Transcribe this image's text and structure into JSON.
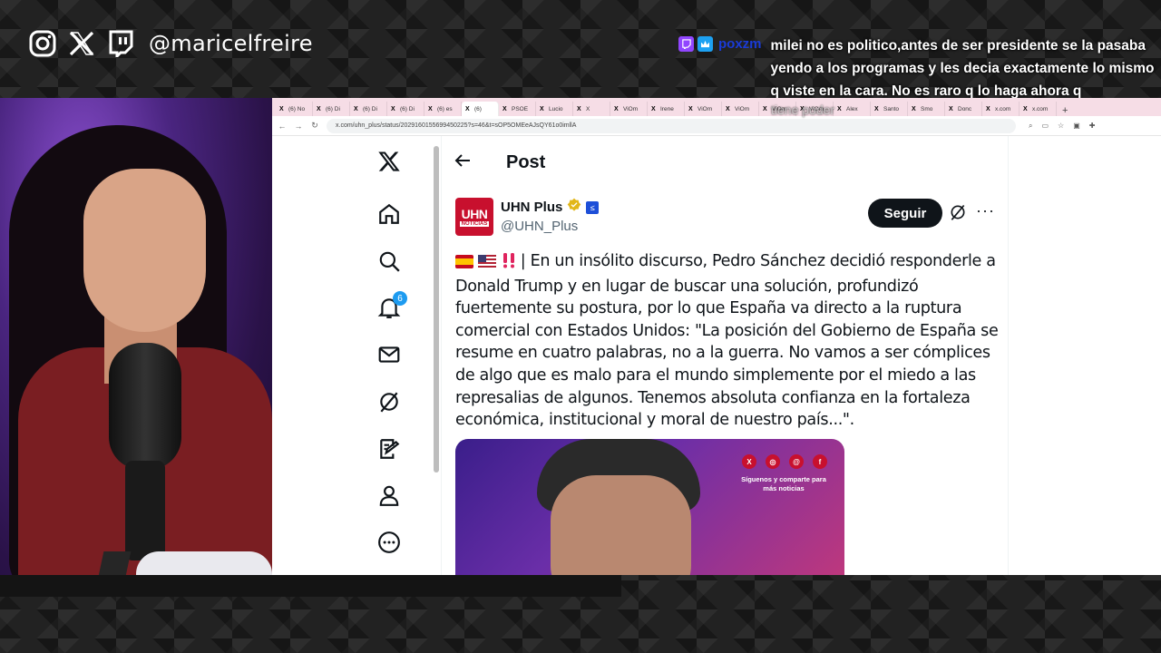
{
  "streamer": {
    "handle": "@maricelfreire",
    "social_icons": [
      "instagram-icon",
      "x-icon",
      "twitch-icon"
    ]
  },
  "chat": {
    "username": "poxzm",
    "message": "milei no es politico,antes de ser presidente se la pasaba yendo a los programas y les decia exactamente lo mismo q viste en la cara. No es raro q lo haga ahora q",
    "faded_text": "tiene poder",
    "badges": [
      "twitch-icon",
      "crown-badge-icon"
    ]
  },
  "browser": {
    "tabs": [
      {
        "label": "(6) No"
      },
      {
        "label": "(6) Di"
      },
      {
        "label": "(6) Di"
      },
      {
        "label": "(6) Di"
      },
      {
        "label": "(6) es"
      },
      {
        "label": "(6)"
      },
      {
        "label": "PSOE"
      },
      {
        "label": "Lucio"
      },
      {
        "label": "X"
      },
      {
        "label": "ViOm"
      },
      {
        "label": "Irene"
      },
      {
        "label": "ViOm"
      },
      {
        "label": "ViOm"
      },
      {
        "label": "ViOm"
      },
      {
        "label": "ViOm"
      },
      {
        "label": "Alex"
      },
      {
        "label": "Santo"
      },
      {
        "label": "Smo"
      },
      {
        "label": "Donc"
      },
      {
        "label": "x.com"
      },
      {
        "label": "x.com"
      }
    ],
    "url": "x.com/uhn_plus/status/2029160155699450225?s=46&t=sOP5OMEeAJsQY61o0imllA"
  },
  "x_app": {
    "nav": [
      {
        "name": "x-logo-icon"
      },
      {
        "name": "home-icon"
      },
      {
        "name": "search-icon"
      },
      {
        "name": "notifications-icon",
        "badge": "6"
      },
      {
        "name": "messages-icon"
      },
      {
        "name": "grok-icon"
      },
      {
        "name": "compose-icon"
      },
      {
        "name": "profile-icon"
      },
      {
        "name": "more-icon"
      }
    ],
    "post_header": "Post",
    "author": {
      "avatar_text": "UHN",
      "avatar_sub": "NOTICIAS",
      "name": "UHN Plus",
      "handle": "@UHN_Plus"
    },
    "follow_label": "Seguir",
    "more_label": "···",
    "post_body": " | En un insólito discurso, Pedro Sánchez decidió responderle a Donald Trump y en lugar de buscar una solución, profundizó fuertemente su postura, por lo que España va directo a la ruptura comercial con Estados Unidos: \"La posición del Gobierno de España se resume en cuatro palabras, no a la guerra. No vamos a ser cómplices de algo que es malo para el mundo simplemente por el miedo a las represalias de algunos. Tenemos absoluta confianza en la fortaleza económica, institucional y moral de nuestro país...\".",
    "post_emojis": [
      "spain-flag-icon",
      "us-flag-icon",
      "double-exclamation-icon"
    ],
    "image": {
      "caption": "Síguenos y comparte para más noticias",
      "social_icons": [
        "x-icon",
        "instagram-icon",
        "threads-icon",
        "facebook-icon"
      ]
    }
  },
  "colors": {
    "x_blue": "#1d9bf0",
    "uhn_red": "#c8102e",
    "chat_username": "#1a3bd6",
    "tabbar": "#f6dde6"
  }
}
